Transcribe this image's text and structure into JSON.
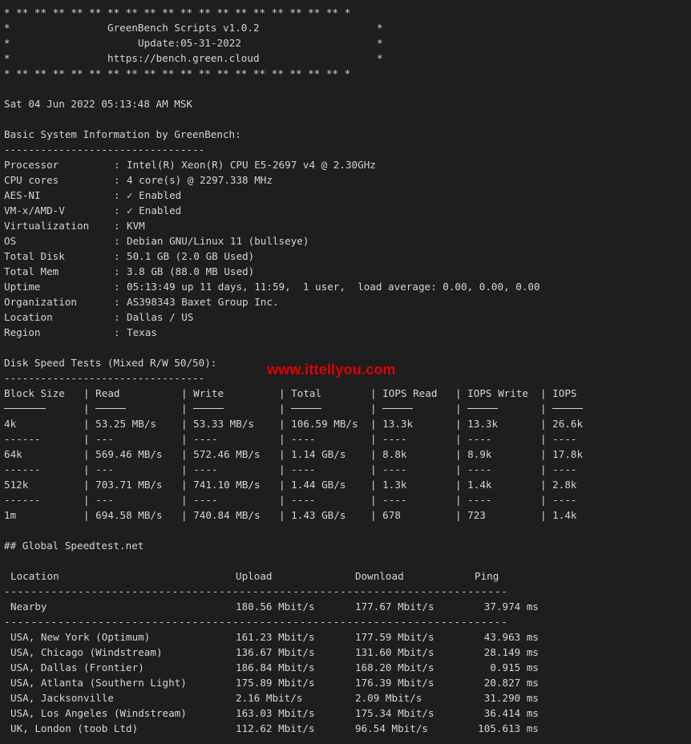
{
  "banner": {
    "border": "* ** ** ** ** ** ** ** ** ** ** ** ** ** ** ** ** ** ** *",
    "title": "GreenBench Scripts v1.0.2",
    "update": "Update:05-31-2022",
    "url": "https://bench.green.cloud"
  },
  "timestamp": "Sat 04 Jun 2022 05:13:48 AM MSK",
  "sysinfo": {
    "heading": "Basic System Information by GreenBench:",
    "rule": "---------------------------------",
    "rows": [
      {
        "label": "Processor",
        "value": "Intel(R) Xeon(R) CPU E5-2697 v4 @ 2.30GHz"
      },
      {
        "label": "CPU cores",
        "value": "4 core(s) @ 2297.338 MHz"
      },
      {
        "label": "AES-NI",
        "value": "✓ Enabled"
      },
      {
        "label": "VM-x/AMD-V",
        "value": "✓ Enabled"
      },
      {
        "label": "Virtualization",
        "value": "KVM"
      },
      {
        "label": "OS",
        "value": "Debian GNU/Linux 11 (bullseye)"
      },
      {
        "label": "Total Disk",
        "value": "50.1 GB (2.0 GB Used)"
      },
      {
        "label": "Total Mem",
        "value": "3.8 GB (88.0 MB Used)"
      },
      {
        "label": "Uptime",
        "value": "05:13:49 up 11 days, 11:59,  1 user,  load average: 0.00, 0.00, 0.00"
      },
      {
        "label": "Organization",
        "value": "AS398343 Baxet Group Inc."
      },
      {
        "label": "Location",
        "value": "Dallas / US"
      },
      {
        "label": "Region",
        "value": "Texas"
      }
    ]
  },
  "disk": {
    "heading": "Disk Speed Tests (Mixed R/W 50/50):",
    "rule": "---------------------------------",
    "watermark": "www.ittellyou.com",
    "headers": [
      "Block Size",
      "Read",
      "Write",
      "Total",
      "IOPS Read",
      "IOPS Write",
      "IOPS"
    ],
    "rows": [
      [
        "4k",
        "53.25 MB/s",
        "53.33 MB/s",
        "106.59 MB/s",
        "13.3k",
        "13.3k",
        "26.6k"
      ],
      [
        "64k",
        "569.46 MB/s",
        "572.46 MB/s",
        "1.14 GB/s",
        "8.8k",
        "8.9k",
        "17.8k"
      ],
      [
        "512k",
        "703.71 MB/s",
        "741.10 MB/s",
        "1.44 GB/s",
        "1.3k",
        "1.4k",
        "2.8k"
      ],
      [
        "1m",
        "694.58 MB/s",
        "740.84 MB/s",
        "1.43 GB/s",
        "678",
        "723",
        "1.4k"
      ]
    ],
    "separator": [
      "------",
      "---",
      "----",
      "----",
      "----",
      "----",
      "----"
    ]
  },
  "speedtest": {
    "heading": "## Global Speedtest.net",
    "headers": [
      "Location",
      "Upload",
      "Download",
      "Ping"
    ],
    "rule": "---------------------------------------------------------------------------",
    "nearby": {
      "location": "Nearby",
      "upload": "180.56 Mbit/s",
      "download": "177.67 Mbit/s",
      "ping": "37.974 ms"
    },
    "rows": [
      {
        "location": "USA, New York (Optimum)",
        "upload": "161.23 Mbit/s",
        "download": "177.59 Mbit/s",
        "ping": "43.963 ms"
      },
      {
        "location": "USA, Chicago (Windstream)",
        "upload": "136.67 Mbit/s",
        "download": "131.60 Mbit/s",
        "ping": "28.149 ms"
      },
      {
        "location": "USA, Dallas (Frontier)",
        "upload": "186.84 Mbit/s",
        "download": "168.20 Mbit/s",
        "ping": "0.915 ms"
      },
      {
        "location": "USA, Atlanta (Southern Light)",
        "upload": "175.89 Mbit/s",
        "download": "176.39 Mbit/s",
        "ping": "20.827 ms"
      },
      {
        "location": "USA, Jacksonville",
        "upload": "2.16 Mbit/s",
        "download": "2.09 Mbit/s",
        "ping": "31.290 ms"
      },
      {
        "location": "USA, Los Angeles (Windstream)",
        "upload": "163.03 Mbit/s",
        "download": "175.34 Mbit/s",
        "ping": "36.414 ms"
      },
      {
        "location": "UK, London (toob Ltd)",
        "upload": "112.62 Mbit/s",
        "download": "96.54 Mbit/s",
        "ping": "105.613 ms"
      }
    ]
  }
}
